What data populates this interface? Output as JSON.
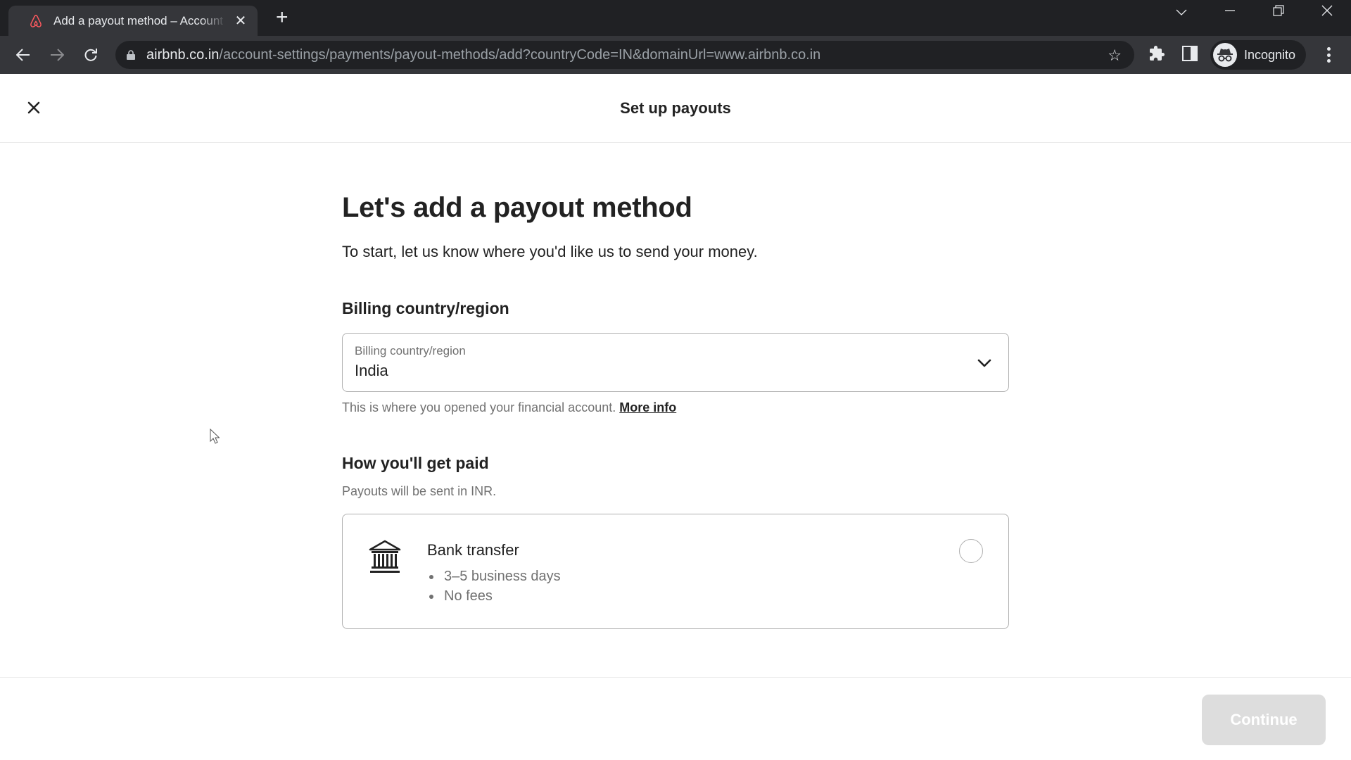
{
  "browser": {
    "tab": {
      "title": "Add a payout method – Account",
      "favicon": "airbnb-logo-icon",
      "favicon_color": "#ff5a5f"
    },
    "url": {
      "host": "airbnb.co.in",
      "path": "/account-settings/payments/payout-methods/add?countryCode=IN&domainUrl=www.airbnb.co.in"
    },
    "profile_label": "Incognito",
    "icons": [
      "back-icon",
      "forward-icon",
      "reload-icon",
      "lock-icon",
      "bookmark-star-icon",
      "extensions-icon",
      "side-panel-icon",
      "incognito-icon",
      "menu-icon",
      "tab-search-icon",
      "minimize-icon",
      "restore-icon",
      "close-window-icon"
    ]
  },
  "page": {
    "header": {
      "title": "Set up payouts",
      "close_icon": "close-icon"
    },
    "heading": "Let's add a payout method",
    "subtitle": "To start, let us know where you'd like us to send your money.",
    "billing": {
      "section_label": "Billing country/region",
      "select_label": "Billing country/region",
      "select_value": "India",
      "helper_text": "This is where you opened your financial account.",
      "helper_link": "More info"
    },
    "payout": {
      "section_label": "How you'll get paid",
      "note": "Payouts will be sent in INR.",
      "methods": [
        {
          "icon": "bank-icon",
          "title": "Bank transfer",
          "details": [
            "3–5 business days",
            "No fees"
          ],
          "selected": false
        }
      ]
    },
    "footer": {
      "continue_label": "Continue",
      "continue_disabled": true
    }
  },
  "colors": {
    "text_primary": "#222222",
    "text_secondary": "#717171",
    "border": "#b0b0b0",
    "button_disabled": "#dddddd"
  }
}
